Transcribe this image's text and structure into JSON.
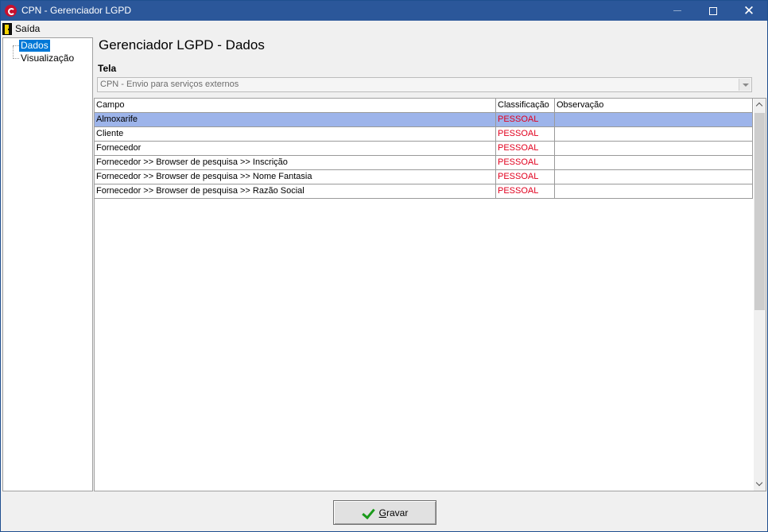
{
  "window": {
    "title": "CPN - Gerenciador LGPD"
  },
  "menubar": {
    "exit_label": "Saída"
  },
  "tree": {
    "items": [
      {
        "label": "Dados",
        "selected": true
      },
      {
        "label": "Visualização",
        "selected": false
      }
    ]
  },
  "main": {
    "heading": "Gerenciador LGPD - Dados",
    "tela_label": "Tela",
    "tela_value": "CPN - Envio para serviços externos"
  },
  "grid": {
    "columns": [
      "Campo",
      "Classificação",
      "Observação"
    ],
    "rows": [
      {
        "campo": "Almoxarife",
        "classificacao": "PESSOAL",
        "observacao": "",
        "selected": true
      },
      {
        "campo": "Cliente",
        "classificacao": "PESSOAL",
        "observacao": ""
      },
      {
        "campo": "Fornecedor",
        "classificacao": "PESSOAL",
        "observacao": ""
      },
      {
        "campo": "Fornecedor >> Browser de pesquisa >> Inscrição",
        "classificacao": "PESSOAL",
        "observacao": ""
      },
      {
        "campo": "Fornecedor >> Browser de pesquisa >> Nome Fantasia",
        "classificacao": "PESSOAL",
        "observacao": ""
      },
      {
        "campo": "Fornecedor >> Browser de pesquisa >> Razão Social",
        "classificacao": "PESSOAL",
        "observacao": ""
      }
    ]
  },
  "footer": {
    "save_label": "Gravar"
  },
  "colors": {
    "titlebar": "#2b579a",
    "selection": "#9db4ea",
    "classification_text": "#e1001e"
  },
  "icons": {
    "app": "cpn-logo-icon",
    "exit": "exit-door-icon",
    "save": "checkmark-icon"
  }
}
